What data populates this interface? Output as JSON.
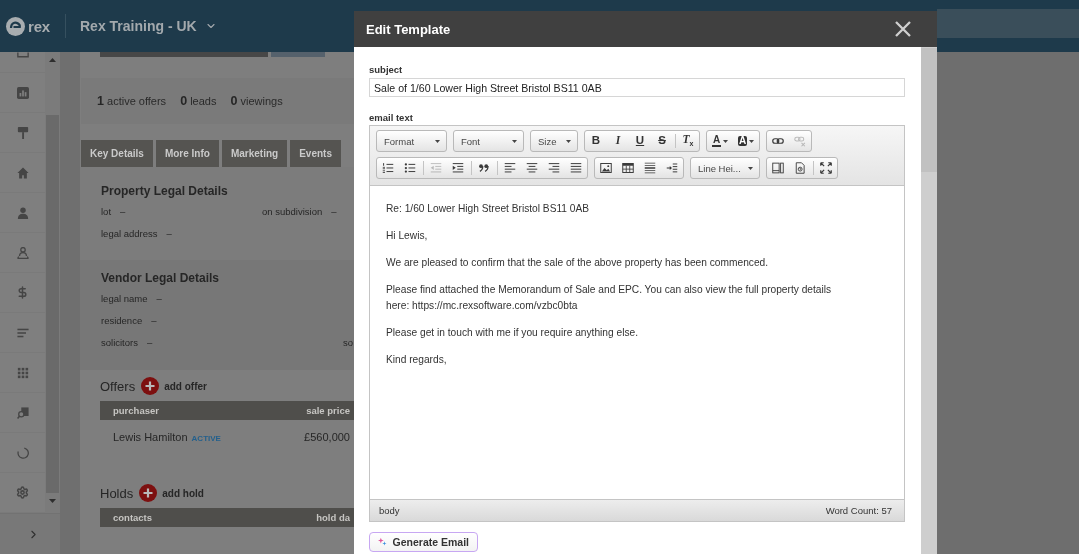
{
  "header": {
    "logo": "rex",
    "account": "Rex Training - UK"
  },
  "sidebar": {
    "expanded": false
  },
  "listing": {
    "stats": [
      {
        "count": "1",
        "label": "active offers"
      },
      {
        "count": "0",
        "label": "leads"
      },
      {
        "count": "0",
        "label": "viewings"
      }
    ],
    "tabs": [
      {
        "label": "Key Details",
        "selected": false
      },
      {
        "label": "More Info",
        "selected": false
      },
      {
        "label": "Marketing",
        "selected": false
      },
      {
        "label": "Events",
        "selected": false
      }
    ],
    "sections": [
      {
        "title": "Property Legal Details",
        "rows": [
          [
            {
              "label": "lot",
              "value": "–"
            },
            {
              "label": "on subdivision",
              "value": "–"
            }
          ],
          [
            {
              "label": "legal address",
              "value": "–"
            }
          ]
        ]
      },
      {
        "title": "Vendor Legal Details",
        "rows": [
          [
            {
              "label": "legal name",
              "value": "–"
            }
          ],
          [
            {
              "label": "residence",
              "value": "–"
            }
          ],
          [
            {
              "label": "solicitors",
              "value": "–"
            },
            {
              "label": "so"
            }
          ]
        ]
      }
    ],
    "offers": {
      "title": "Offers",
      "add_label": "add offer",
      "columns": [
        "purchaser",
        "sale price"
      ],
      "rows": [
        {
          "purchaser": "Lewis Hamilton",
          "status": "ACTIVE",
          "sale_price": "£560,000"
        }
      ]
    },
    "holds": {
      "title": "Holds",
      "add_label": "add hold",
      "columns": [
        "contacts",
        "hold da"
      ]
    }
  },
  "modal": {
    "title": "Edit Template",
    "subject": {
      "label": "subject",
      "value": "Sale of 1/60 Lower High Street Bristol BS11 0AB"
    },
    "email_text": {
      "label": "email text",
      "toolbar": [
        [
          {
            "kind": "dropdown",
            "label": "Format"
          },
          {
            "kind": "dropdown",
            "label": "Font"
          },
          {
            "kind": "dropdown",
            "label": "Size"
          },
          {
            "kind": "group",
            "buttons": [
              {
                "kind": "bold",
                "glyph": "B",
                "disabled": false
              },
              {
                "kind": "italic",
                "glyph": "I",
                "disabled": false
              },
              {
                "kind": "underline",
                "glyph": "U",
                "disabled": false
              },
              {
                "kind": "strike",
                "glyph": "S",
                "disabled": false
              },
              {
                "kind": "separator"
              },
              {
                "kind": "remove_format",
                "glyph": "T$_{x}$",
                "disabled": false
              }
            ]
          },
          {
            "kind": "group",
            "buttons": [
              {
                "kind": "text_color",
                "glyph": "A",
                "disabled": false
              },
              {
                "kind": "background_color",
                "glyph": "A",
                "disabled": false
              }
            ]
          },
          {
            "kind": "group",
            "buttons": [
              {
                "kind": "link",
                "disabled": false
              },
              {
                "kind": "unlink",
                "disabled": true
              }
            ]
          }
        ],
        [
          {
            "kind": "group",
            "buttons": [
              {
                "kind": "numbered_list",
                "disabled": false
              },
              {
                "kind": "bulleted_list",
                "disabled": false
              },
              {
                "kind": "separator"
              },
              {
                "kind": "outdent",
                "disabled": true
              },
              {
                "kind": "indent",
                "disabled": false
              },
              {
                "kind": "separator"
              },
              {
                "kind": "blockquote",
                "disabled": false
              },
              {
                "kind": "separator"
              },
              {
                "kind": "align_left",
                "disabled": false
              },
              {
                "kind": "align_center",
                "disabled": false
              },
              {
                "kind": "align_right",
                "disabled": false
              },
              {
                "kind": "justify",
                "disabled": false
              }
            ]
          },
          {
            "kind": "group",
            "buttons": [
              {
                "kind": "image",
                "disabled": false
              },
              {
                "kind": "table",
                "disabled": false
              },
              {
                "kind": "horizontal_line",
                "disabled": false
              },
              {
                "kind": "page_break",
                "disabled": false
              }
            ]
          },
          {
            "kind": "dropdown",
            "label": "Line Hei..."
          },
          {
            "kind": "group",
            "buttons": [
              {
                "kind": "templates",
                "disabled": false
              },
              {
                "kind": "preview",
                "disabled": false
              },
              {
                "kind": "separator"
              },
              {
                "kind": "maximize",
                "disabled": false
              }
            ]
          }
        ]
      ],
      "paragraphs": [
        "Re: 1/60 Lower High Street Bristol BS11 0AB",
        "Hi Lewis,",
        "We are pleased to confirm that the sale of the above property has been commenced.",
        "Please find attached the Memorandum of Sale and EPC. You can also view the full property details\nhere: https://mc.rexsoftware.com/vzbc0bta",
        "Please get in touch with me if you require anything else.",
        "Kind regards,"
      ],
      "element_path": "body",
      "word_count": "Word Count: 57"
    },
    "generate_button": "Generate Email"
  }
}
